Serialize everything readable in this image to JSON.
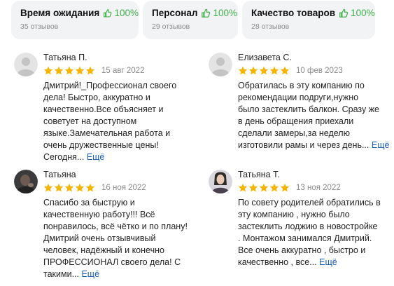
{
  "aspects": [
    {
      "name": "Время ожидания",
      "percent": "100%",
      "count": "35 отзывов"
    },
    {
      "name": "Персонал",
      "percent": "100%",
      "count": "29 отзывов"
    },
    {
      "name": "Качество товаров",
      "percent": "100%",
      "count": "28 отзывов"
    }
  ],
  "colors": {
    "star": "#f5b400",
    "positive": "#3fae49",
    "more_link": "#1a5fb4",
    "card_bg": "#f2f3f5"
  },
  "reviews": [
    {
      "author": "Татьяна П.",
      "date": "15 авг 2022",
      "rating": 5,
      "avatar": "placeholder-avatar-icon",
      "lines": [
        "Дмитрий!_Профессионал своего",
        "дела! Быстро, аккуратно и",
        "качественно.Все объясняет и",
        "советует на доступном",
        "языке.Замечательная работа и",
        "очень дружественные цены!",
        "Сегодня..."
      ],
      "more": "Ещё"
    },
    {
      "author": "Елизавета С.",
      "date": "10 фев 2023",
      "rating": 5,
      "avatar": "placeholder-avatar-icon",
      "lines": [
        "Обратилась в эту компанию по",
        "рекомендации подруги,нужно",
        "было застеклить балкон. Сразу же",
        "в день обращения приехали",
        "сделали замеры,за неделю",
        "изготовили рамы и через день..."
      ],
      "more": "Ещё"
    },
    {
      "author": "Татьяна",
      "date": "16 ноя 2022",
      "rating": 5,
      "avatar": "user-photo",
      "lines": [
        "Спасибо за быструю и",
        "качественную работу!!! Всё",
        "понравилось, всё чётко и по плану!",
        "Дмитрий очень отзывчивый",
        "человек, надёжный и конечно",
        "ПРОФЕССИОНАЛ своего дела! С",
        "такими..."
      ],
      "more": "Ещё"
    },
    {
      "author": "Татьяна Т.",
      "date": "13 ноя 2022",
      "rating": 5,
      "avatar": "user-photo",
      "lines": [
        "По совету родителей обратились в",
        "эту компанию , нужно было",
        "застеклить лоджию в новостройке",
        ". Монтажом занимался Дмитрий.",
        "Все очень аккуратно , быстро и",
        "качественно , все..."
      ],
      "more": "Ещё"
    }
  ]
}
